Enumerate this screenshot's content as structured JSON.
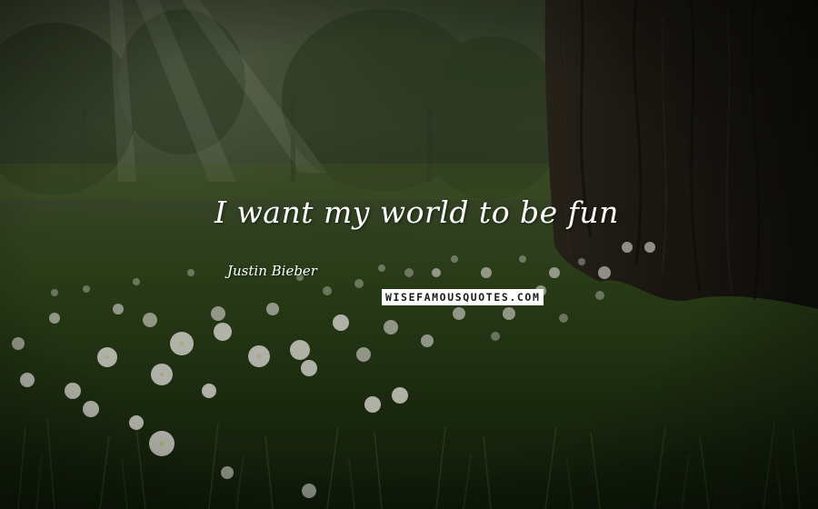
{
  "quote": {
    "text": "I want my world to be fun",
    "author": "Justin Bieber"
  },
  "watermark": {
    "text": "WISEFAMOUSQUOTES.COM"
  },
  "colors": {
    "quote_text": "#ffffff",
    "watermark_background": "#ffffff",
    "watermark_text": "#1c1c1c",
    "foliage_dark": "#1a2414",
    "tree_bark": "#241d17",
    "flower_petal": "#e8e6df"
  }
}
